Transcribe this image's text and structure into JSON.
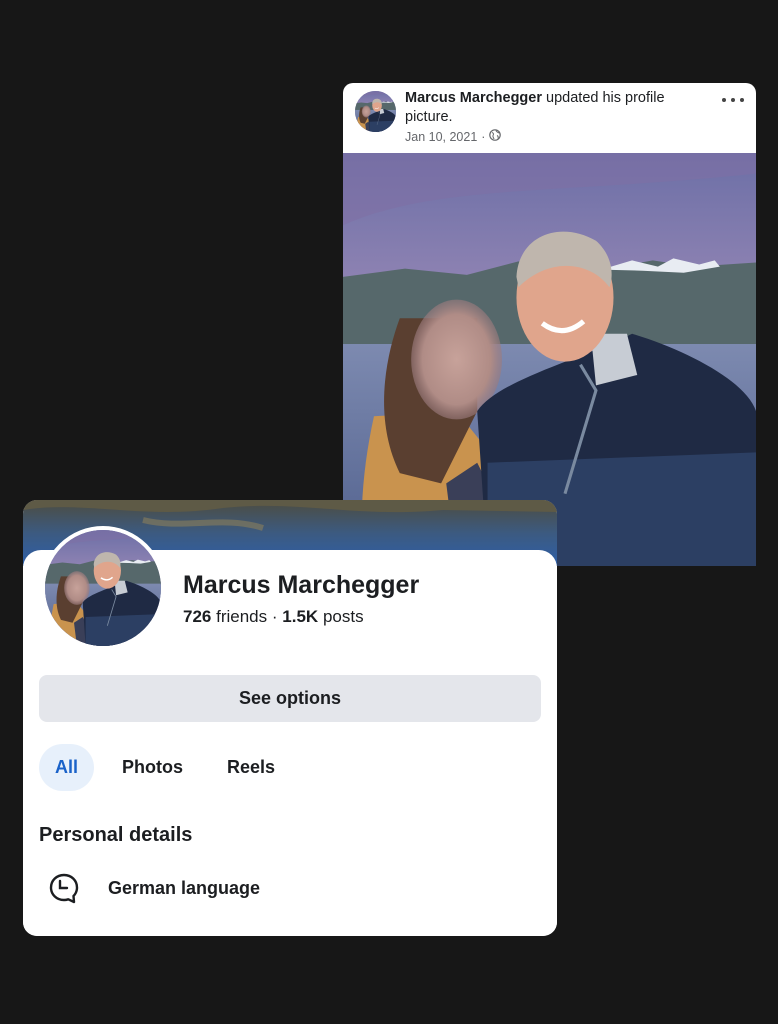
{
  "post": {
    "author": "Marcus Marchegger",
    "action_text": "updated his profile picture.",
    "date": "Jan 10, 2021",
    "separator": "·",
    "privacy_icon": "globe-icon",
    "more_icon": "ellipsis-icon"
  },
  "profile": {
    "name": "Marcus Marchegger",
    "friends_count": "726",
    "friends_label": "friends",
    "stats_separator": "·",
    "posts_count": "1.5K",
    "posts_label": "posts",
    "see_options_label": "See options",
    "tabs": [
      {
        "label": "All",
        "active": true
      },
      {
        "label": "Photos",
        "active": false
      },
      {
        "label": "Reels",
        "active": false
      }
    ],
    "section_title": "Personal details",
    "details": [
      {
        "icon": "speech-bubble-clock-icon",
        "label": "German language"
      }
    ]
  },
  "colors": {
    "background": "#171717",
    "card": "#ffffff",
    "accent_blue": "#1a62c9",
    "tab_active_bg": "#e7f0fb",
    "button_bg": "#e4e6eb",
    "text_primary": "#1c1e21",
    "text_secondary": "#65676b"
  }
}
